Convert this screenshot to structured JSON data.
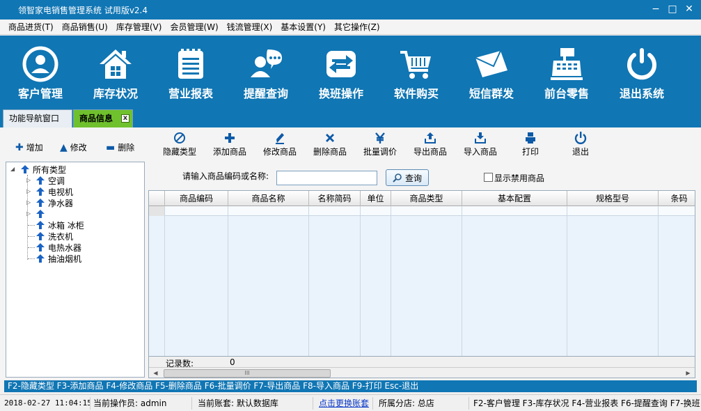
{
  "window": {
    "title": "领智家电销售管理系统 试用版v2.4"
  },
  "menu": [
    "商品进货(T)",
    "商品销售(U)",
    "库存管理(V)",
    "会员管理(W)",
    "钱流管理(X)",
    "基本设置(Y)",
    "其它操作(Z)"
  ],
  "bigbar": [
    {
      "label": "客户管理",
      "icon": "user-icon"
    },
    {
      "label": "库存状况",
      "icon": "house-icon"
    },
    {
      "label": "营业报表",
      "icon": "report-icon"
    },
    {
      "label": "提醒查询",
      "icon": "reminder-icon"
    },
    {
      "label": "换班操作",
      "icon": "shift-icon"
    },
    {
      "label": "软件购买",
      "icon": "cart-icon"
    },
    {
      "label": "短信群发",
      "icon": "mail-icon"
    },
    {
      "label": "前台零售",
      "icon": "register-icon"
    },
    {
      "label": "退出系统",
      "icon": "power-icon"
    }
  ],
  "tabs": {
    "nav": "功能导航窗口",
    "active": "商品信息",
    "close": "x"
  },
  "leftbar": {
    "add": "增加",
    "edit": "修改",
    "delete": "删除"
  },
  "tree": {
    "root": "所有类型",
    "children": [
      "空调",
      "电视机",
      "净水器",
      "",
      "冰箱 冰柜",
      "洗衣机",
      "电热水器",
      "抽油烟机"
    ]
  },
  "toolbar": [
    {
      "label": "隐藏类型",
      "glyph": "⊘"
    },
    {
      "label": "添加商品",
      "glyph": "+"
    },
    {
      "label": "修改商品",
      "glyph": "✎"
    },
    {
      "label": "删除商品",
      "glyph": "✖"
    },
    {
      "label": "批量调价",
      "glyph": "¥"
    },
    {
      "label": "导出商品",
      "glyph": "⇧"
    },
    {
      "label": "导入商品",
      "glyph": "⇩"
    },
    {
      "label": "打印",
      "glyph": "🖶"
    },
    {
      "label": "退出",
      "glyph": "⏻"
    }
  ],
  "search": {
    "label": "请输入商品编码或名称:",
    "value": "",
    "button": "查询",
    "checkbox_label": "显示禁用商品",
    "checkbox_checked": false
  },
  "grid": {
    "columns": [
      "商品编码",
      "商品名称",
      "名称简码",
      "单位",
      "商品类型",
      "基本配置",
      "规格型号",
      "条码"
    ],
    "footer_label": "记录数:",
    "footer_value": "0",
    "scroll_thumb": "III"
  },
  "shortcuts": "F2-隐藏类型 F3-添加商品 F4-修改商品 F5-删除商品 F6-批量调价 F7-导出商品 F8-导入商品 F9-打印 Esc-退出",
  "status": {
    "datetime": "2018-02-27 11:04:15",
    "operator": "当前操作员: admin",
    "account": "当前账套: 默认数据库",
    "switch_link": "点击更换账套",
    "branch": "所属分店: 总店",
    "keys": "F2-客户管理 F3-库存状况 F4-营业报表 F6-提醒查询 F7-换班"
  },
  "colors": {
    "brand_blue": "#1076b4",
    "tab_active": "#6fc12d",
    "grid_bg": "#eaf3fb"
  }
}
